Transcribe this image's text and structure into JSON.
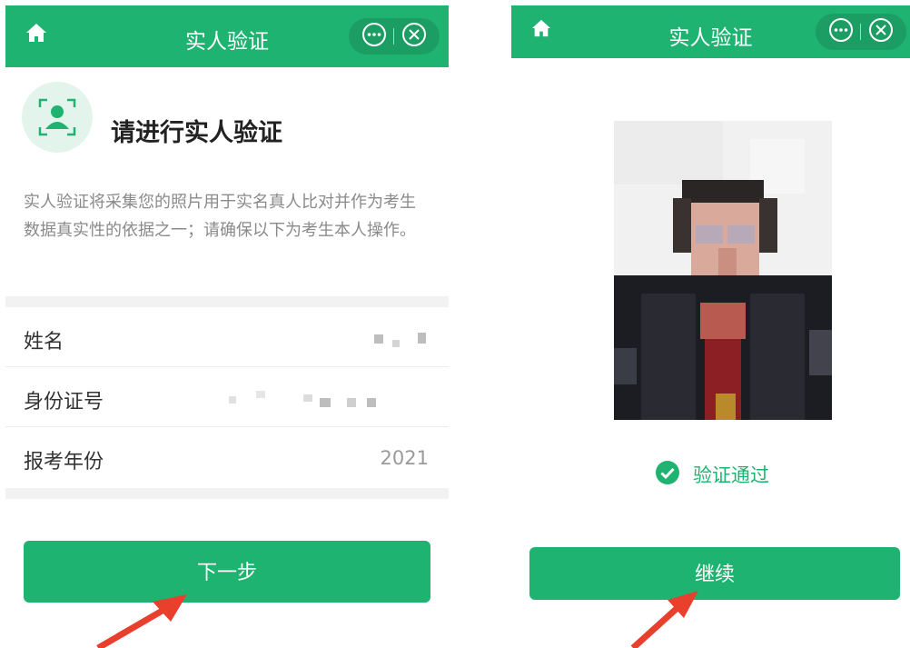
{
  "colors": {
    "brand_green": "#1fb371",
    "arrow_red": "#e8402d",
    "muted_text": "#8a8a8a"
  },
  "left_screen": {
    "nav": {
      "title": "实人验证",
      "icons": [
        "home-icon",
        "more-dots-icon",
        "close-circle-icon"
      ]
    },
    "heading": "请进行实人验证",
    "heading_icon": "face-scan-icon",
    "description": "实人验证将采集您的照片用于实名真人比对并作为考生数据真实性的依据之一；请确保以下为考生本人操作。",
    "rows": [
      {
        "label": "姓名",
        "value": ""
      },
      {
        "label": "身份证号",
        "value": ""
      },
      {
        "label": "报考年份",
        "value": "2021"
      }
    ],
    "button_label": "下一步"
  },
  "right_screen": {
    "nav": {
      "title": "实人验证",
      "icons": [
        "home-icon",
        "more-dots-icon",
        "close-circle-icon"
      ]
    },
    "photo_icon": "pixelated-face-photo",
    "status_icon": "check-circle-icon",
    "status_text": "验证通过",
    "button_label": "继续"
  }
}
